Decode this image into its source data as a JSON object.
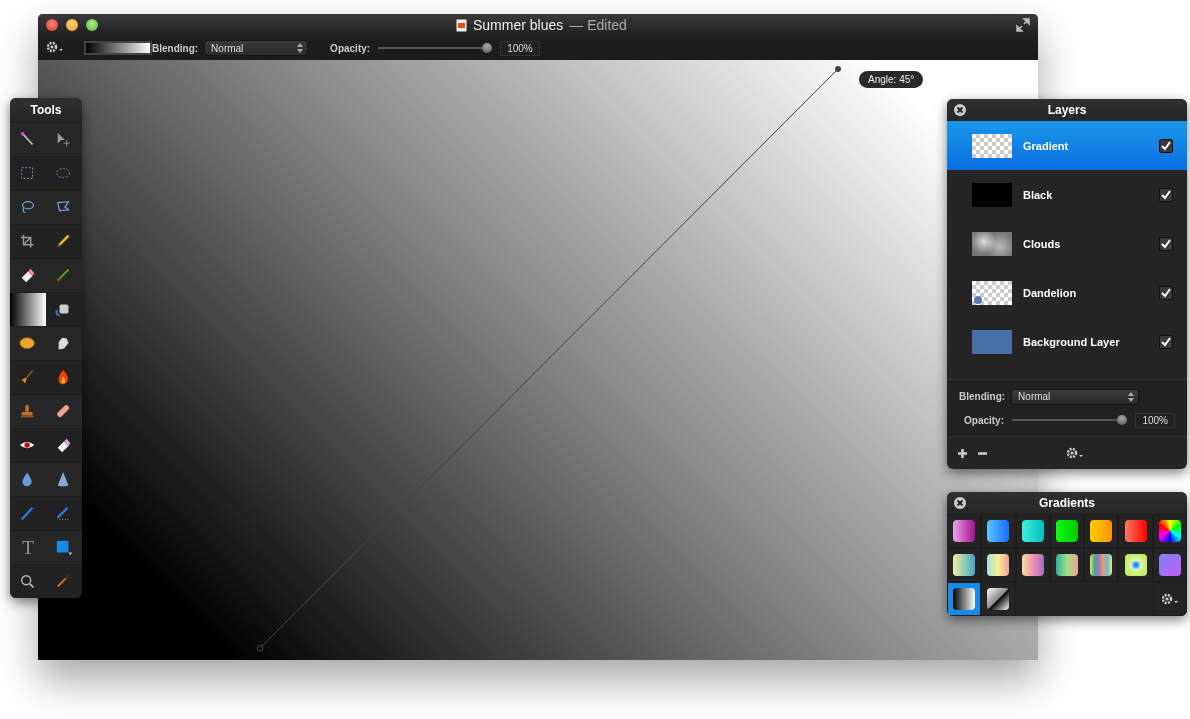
{
  "window": {
    "title": "Summer blues",
    "status": "— Edited"
  },
  "toolbar": {
    "blending_label": "Blending:",
    "blending_value": "Normal",
    "opacity_label": "Opacity:",
    "opacity": {
      "level": 1.0,
      "value": "100%"
    }
  },
  "canvas": {
    "angle_tooltip": "Angle: 45°"
  },
  "tools": {
    "title": "Tools",
    "items": [
      {
        "selected": false
      },
      {
        "selected": false
      },
      {
        "selected": false
      },
      {
        "selected": false
      },
      {
        "selected": false
      },
      {
        "selected": false
      },
      {
        "selected": false
      },
      {
        "selected": false
      },
      {
        "selected": false
      },
      {
        "selected": false
      },
      {
        "selected": true
      },
      {
        "selected": false
      },
      {
        "selected": false
      },
      {
        "selected": false
      },
      {
        "selected": false
      },
      {
        "selected": false
      },
      {
        "selected": false
      },
      {
        "selected": false
      },
      {
        "selected": false
      },
      {
        "selected": false
      },
      {
        "selected": false
      },
      {
        "selected": false
      },
      {
        "selected": false
      },
      {
        "selected": false
      },
      {
        "selected": false,
        "label": "T"
      },
      {
        "selected": false
      },
      {
        "selected": false
      },
      {
        "selected": false
      }
    ]
  },
  "layers": {
    "title": "Layers",
    "items": [
      {
        "name": "Gradient",
        "kind": "transparent",
        "selected": true,
        "visible": true
      },
      {
        "name": "Black",
        "kind": "black",
        "selected": false,
        "visible": true
      },
      {
        "name": "Clouds",
        "kind": "clouds",
        "selected": false,
        "visible": true
      },
      {
        "name": "Dandelion",
        "kind": "dandelion",
        "selected": false,
        "visible": true
      },
      {
        "name": "Background Layer",
        "kind": "fill",
        "selected": false,
        "visible": true
      }
    ],
    "blending_label": "Blending:",
    "blending_value": "Normal",
    "opacity_label": "Opacity:",
    "opacity": {
      "level": 1.0,
      "value": "100%"
    }
  },
  "gradients": {
    "title": "Gradients",
    "items": [
      {
        "selected": false
      },
      {
        "selected": false
      },
      {
        "selected": false
      },
      {
        "selected": false
      },
      {
        "selected": false
      },
      {
        "selected": false
      },
      {
        "selected": false
      },
      {
        "selected": false
      },
      {
        "selected": false
      },
      {
        "selected": false
      },
      {
        "selected": false
      },
      {
        "selected": false
      },
      {
        "selected": false
      },
      {
        "selected": false
      },
      {
        "selected": true
      },
      {
        "selected": false
      }
    ]
  }
}
